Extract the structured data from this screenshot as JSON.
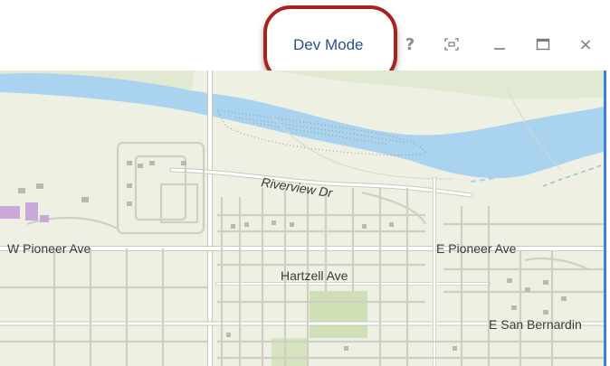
{
  "toolbar": {
    "dev_mode_label": "Dev Mode",
    "help_label": "?",
    "close_label": "×"
  },
  "map": {
    "labels": {
      "riverview": "Riverview Dr",
      "w_pioneer": "W Pioneer Ave",
      "e_pioneer": "E Pioneer Ave",
      "hartzell": "Hartzell Ave",
      "san_bernardino": "E San Bernardin"
    },
    "colors": {
      "water": "#a9d3ef",
      "land": "#eef0e4",
      "park": "#cfe0b6",
      "road": "#ffffff",
      "road_outline": "#c9c9bd",
      "building": "#c8a9d9",
      "highlight": "#a8221f"
    }
  }
}
